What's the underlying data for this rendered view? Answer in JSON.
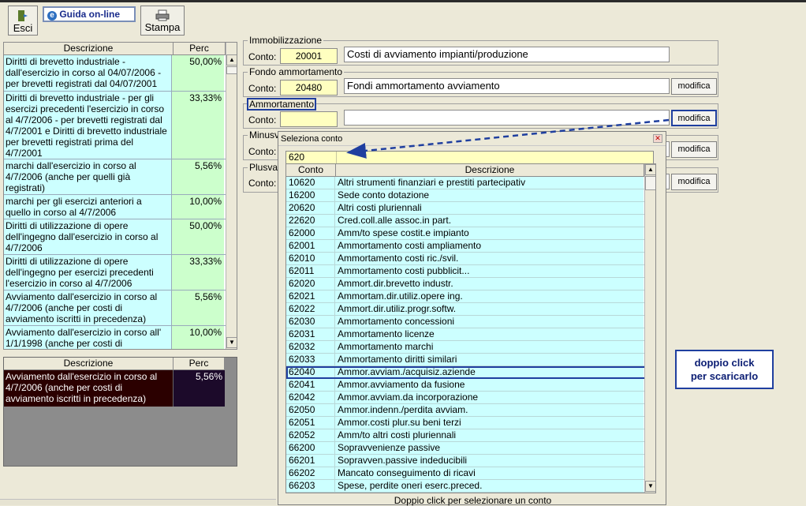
{
  "toolbar": {
    "exit_label": "Esci",
    "help_label": "Guida on-line",
    "print_label": "Stampa"
  },
  "rates_table": {
    "col_desc": "Descrizione",
    "col_perc": "Perc",
    "rows": [
      {
        "desc": "Diritti di brevetto industriale - dall'esercizio in corso al 04/07/2006 - per brevetti registrati dal 04/07/2001",
        "perc": "50,00%"
      },
      {
        "desc": "Diritti di brevetto industriale  - per gli esercizi precedenti l'esercizio in corso al 4/7/2006 - per brevetti registrati dal 4/7/2001 e Diritti di brevetto industriale  per brevetti registrati prima del 4/7/2001",
        "perc": "33,33%"
      },
      {
        "desc": "marchi dall'esercizio in corso al 4/7/2006 (anche per quelli già registrati)",
        "perc": "5,56%"
      },
      {
        "desc": "marchi per gli esercizi anteriori a quello in corso al 4/7/2006",
        "perc": "10,00%"
      },
      {
        "desc": "Diritti di utilizzazione di opere dell'ingegno dall'esercizio in corso al 4/7/2006",
        "perc": "50,00%"
      },
      {
        "desc": "Diritti di utilizzazione di opere dell'ingegno per esercizi precedenti l'esercizio in corso al 4/7/2006",
        "perc": "33,33%"
      },
      {
        "desc": "Avviamento dall'esercizio in corso al 4/7/2006  (anche per costi di avviamento iscritti in precedenza)",
        "perc": "5,56%"
      },
      {
        "desc": "Avviamento dall'esercizio in corso all' 1/1/1998  (anche per costi di",
        "perc": "10,00%"
      }
    ]
  },
  "selected_table": {
    "col_desc": "Descrizione",
    "col_perc": "Perc",
    "row": {
      "desc": "Avviamento dall'esercizio in corso al 4/7/2006  (anche per costi di avviamento iscritti in precedenza)",
      "perc": "5,56%"
    }
  },
  "sections": {
    "immobilizzazione": {
      "legend": "Immobilizzazione",
      "label": "Conto:",
      "code": "20001",
      "desc": "Costi di avviamento impianti/produzione"
    },
    "fondo": {
      "legend": "Fondo ammortamento",
      "label": "Conto:",
      "code": "20480",
      "desc": "Fondi ammortamento avviamento",
      "button": "modifica"
    },
    "ammortamento": {
      "legend": "Ammortamento",
      "label": "Conto:",
      "code": "",
      "desc": "",
      "button": "modifica"
    },
    "minusvalenze": {
      "legend": "Minusv",
      "label": "Conto:",
      "button": "modifica"
    },
    "plusvalenze": {
      "legend": "Plusval",
      "label": "Conto:",
      "button": "modifica"
    }
  },
  "popup": {
    "title": "Seleziona conto",
    "search_value": "620",
    "col_code": "Conto",
    "col_desc": "Descrizione",
    "footer": "Doppio click per selezionare un conto",
    "selected_index": 15,
    "rows": [
      {
        "code": "10620",
        "desc": "Altri strumenti finanziari e prestiti partecipativ"
      },
      {
        "code": "16200",
        "desc": "Sede conto dotazione"
      },
      {
        "code": "20620",
        "desc": "Altri costi pluriennali"
      },
      {
        "code": "22620",
        "desc": "Cred.coll.alle assoc.in part."
      },
      {
        "code": "62000",
        "desc": "Amm/to spese costit.e impianto"
      },
      {
        "code": "62001",
        "desc": "Ammortamento costi ampliamento"
      },
      {
        "code": "62010",
        "desc": "Ammortamento costi ric./svil."
      },
      {
        "code": "62011",
        "desc": "Ammortamento costi pubblicit..."
      },
      {
        "code": "62020",
        "desc": "Ammort.dir.brevetto industr."
      },
      {
        "code": "62021",
        "desc": "Ammortam.dir.utiliz.opere ing."
      },
      {
        "code": "62022",
        "desc": "Ammort.dir.utiliz.progr.softw."
      },
      {
        "code": "62030",
        "desc": "Ammortamento concessioni"
      },
      {
        "code": "62031",
        "desc": "Ammortamento licenze"
      },
      {
        "code": "62032",
        "desc": "Ammortamento marchi"
      },
      {
        "code": "62033",
        "desc": "Ammortamento diritti similari"
      },
      {
        "code": "62040",
        "desc": "Ammor.avviam./acquisiz.aziende"
      },
      {
        "code": "62041",
        "desc": "Ammor.avviamento da fusione"
      },
      {
        "code": "62042",
        "desc": "Ammor.avviam.da incorporazione"
      },
      {
        "code": "62050",
        "desc": "Ammor.indenn./perdita avviam."
      },
      {
        "code": "62051",
        "desc": "Ammor.costi plur.su beni terzi"
      },
      {
        "code": "62052",
        "desc": "Amm/to altri costi pluriennali"
      },
      {
        "code": "66200",
        "desc": "Sopravvenienze passive"
      },
      {
        "code": "66201",
        "desc": "Sopravven.passive indeducibili"
      },
      {
        "code": "66202",
        "desc": "Mancato conseguimento di ricavi"
      },
      {
        "code": "66203",
        "desc": "Spese, perdite oneri eserc.preced."
      }
    ]
  },
  "callout": {
    "line1": "doppio click",
    "line2": "per scaricarlo"
  },
  "colors": {
    "accent": "#1f3f9f",
    "row_bg": "#ccffff",
    "perc_bg": "#ccffcc",
    "code_bg": "#ffffc0",
    "selected_row_bg": "#2b0000"
  }
}
